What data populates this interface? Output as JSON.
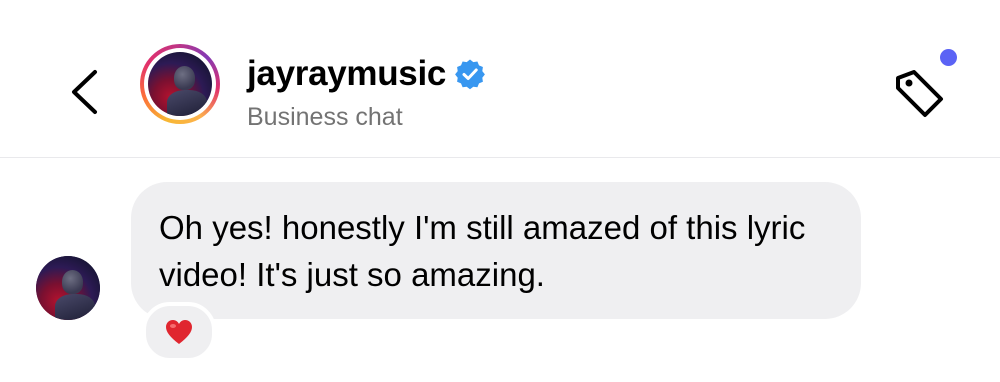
{
  "header": {
    "username": "jayraymusic",
    "subtitle": "Business chat",
    "verified": true,
    "notification_dot_color": "#5b63f5",
    "icons": {
      "back": "chevron-left-icon",
      "tag": "tag-icon",
      "verified": "verified-badge-icon"
    }
  },
  "messages": [
    {
      "sender": "jayraymusic",
      "text": "Oh yes! honestly I'm still amazed of this lyric video! It's just so amazing.",
      "reaction": "heart",
      "bubble_color": "#efeff1"
    }
  ],
  "colors": {
    "verified_blue": "#3897f0",
    "reaction_heart": "#e0262f",
    "subtitle_gray": "#737373"
  }
}
